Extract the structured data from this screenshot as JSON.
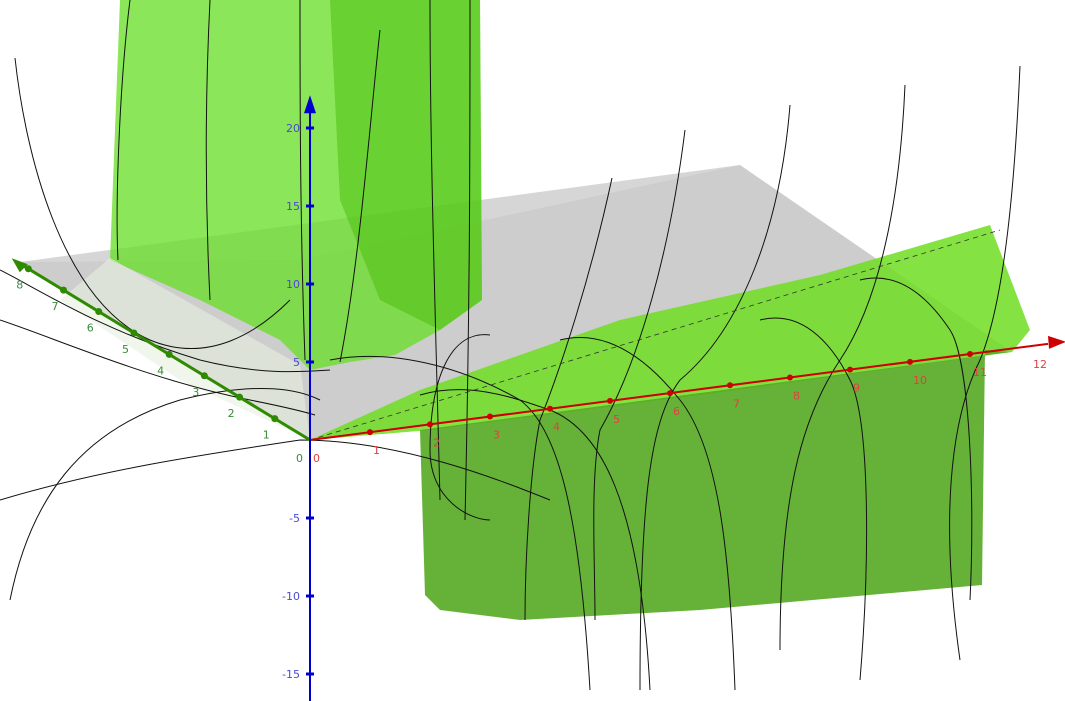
{
  "colors": {
    "x_axis": "#cc0000",
    "y_axis": "#2e8b00",
    "z_axis": "#0000cc",
    "surface": "#66dd22",
    "surface_dark": "#55aa22",
    "plane": "#c8c8c8",
    "curve": "#111111",
    "x_label": "#e04040",
    "y_label": "#3a8a3a",
    "z_label": "#4a4ad0"
  },
  "chart_data": {
    "type": "surface3d",
    "axes": {
      "x": {
        "ticks": [
          "0",
          "1",
          "2",
          "3",
          "4",
          "5",
          "6",
          "7",
          "8",
          "9",
          "10",
          "11",
          "12"
        ],
        "range": [
          0,
          12
        ]
      },
      "y": {
        "ticks": [
          "0",
          "1",
          "2",
          "3",
          "4",
          "5",
          "6",
          "7",
          "8"
        ],
        "range": [
          0,
          8
        ]
      },
      "z": {
        "ticks": [
          "-15",
          "-10",
          "-5",
          "5",
          "10",
          "15",
          "20"
        ],
        "range": [
          -15,
          20
        ]
      }
    },
    "origin_label": "0",
    "grid": false,
    "surfaces": [
      {
        "name": "",
        "description": ""
      }
    ]
  }
}
